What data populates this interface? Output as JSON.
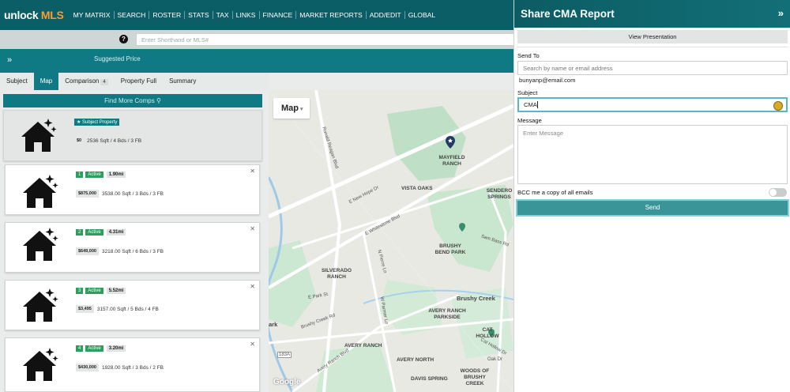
{
  "app": {
    "logo_main": "unlock",
    "logo_brand": "MLS"
  },
  "nav": [
    "MY MATRIX",
    "SEARCH",
    "ROSTER",
    "STATS",
    "TAX",
    "LINKS",
    "FINANCE",
    "MARKET REPORTS",
    "ADD/EDIT",
    "GLOBAL"
  ],
  "search": {
    "placeholder": "Enter Shorthand or MLS#",
    "help": "?"
  },
  "band": {
    "expand_icon": "»",
    "suggested_price": "Suggested Price"
  },
  "tabs": [
    {
      "label": "Subject"
    },
    {
      "label": "Map"
    },
    {
      "label": "Comparison",
      "badge": "4"
    },
    {
      "label": "Property Full"
    },
    {
      "label": "Summary"
    }
  ],
  "comps": {
    "find_more_label": "Find More Comps",
    "subject": {
      "tag": "Subject Property",
      "price": "$0",
      "details": "2536 Sqft / 4 Bds / 3 FB"
    },
    "items": [
      {
        "num": "1",
        "status": "Active",
        "distance": "1.90mi",
        "price": "$875,000",
        "details": "3538.00 Sqft / 3 Bds / 3 FB"
      },
      {
        "num": "2",
        "status": "Active",
        "distance": "4.31mi",
        "price": "$649,000",
        "details": "3218.00 Sqft / 6 Bds / 3 FB"
      },
      {
        "num": "3",
        "status": "Active",
        "distance": "5.52mi",
        "price": "$3,495",
        "details": "3157.00 Sqft / 5 Bds / 4 FB"
      },
      {
        "num": "4",
        "status": "Active",
        "distance": "3.20mi",
        "price": "$430,000",
        "details": "1928.00 Sqft / 3 Bds / 2 FB"
      }
    ]
  },
  "map": {
    "control_label": "Map",
    "labels": [
      "MAYFIELD RANCH",
      "VISTA OAKS",
      "SENDERO SPRINGS",
      "BRUSHY BEND PARK",
      "SILVERADO RANCH",
      "Brushy Creek",
      "AVERY RANCH PARKSIDE",
      "AVERY RANCH",
      "AVERY NORTH",
      "DAVIS SPRING",
      "WOODS OF BRUSHY CREEK",
      "CAT HOLLOW",
      "ark"
    ],
    "roads": [
      "Ronald Reagan Blvd",
      "E New Hope Dr",
      "E Whitestone Blvd",
      "N Pierre Ln",
      "E Park St",
      "Sam Bass Rd",
      "W Parmer Ln",
      "Avery Ranch Blvd",
      "Brushy Creek Rd",
      "Cat Hollow Dr",
      "Oak Dr",
      "183A"
    ],
    "attribution": "Google"
  },
  "panel": {
    "title": "Share CMA Report",
    "close_icon": "»",
    "view_presentation": "View Presentation",
    "send_to_label": "Send To",
    "send_to_placeholder": "Search by name or email address",
    "recipient": "bunyanp@email.com",
    "subject_label": "Subject",
    "subject_value": "CMA",
    "message_label": "Message",
    "message_placeholder": "Enter Message",
    "bcc_label": "BCC me a copy of all emails",
    "send_label": "Send"
  },
  "colors": {
    "header": "#0b5d66",
    "accent": "#0f7a83",
    "brand_orange": "#ff9a2e",
    "status_active": "#2e9e5e",
    "send": "#3a9599"
  }
}
